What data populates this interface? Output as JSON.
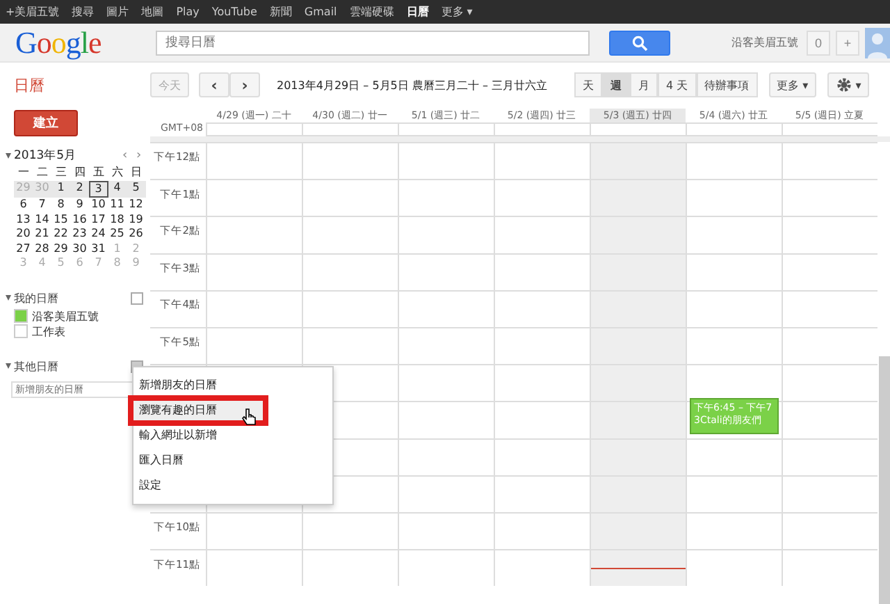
{
  "topbar": {
    "items": [
      {
        "label": "+美眉五號",
        "selected": false
      },
      {
        "label": "搜尋",
        "selected": false
      },
      {
        "label": "圖片",
        "selected": false
      },
      {
        "label": "地圖",
        "selected": false
      },
      {
        "label": "Play",
        "selected": false
      },
      {
        "label": "YouTube",
        "selected": false
      },
      {
        "label": "新聞",
        "selected": false
      },
      {
        "label": "Gmail",
        "selected": false
      },
      {
        "label": "雲端硬碟",
        "selected": false
      },
      {
        "label": "日曆",
        "selected": true
      },
      {
        "label": "更多 ▾",
        "selected": false
      }
    ]
  },
  "header": {
    "logo": "Google",
    "search": {
      "placeholder": "搜尋日曆"
    },
    "user": "沿客美眉五號",
    "notifications": "0",
    "share": "+"
  },
  "toolbar": {
    "app_title": "日曆",
    "today": "今天",
    "prev": "‹",
    "next": "›",
    "date_range": "2013年4月29日 – 5月5日 農曆三月二十 – 三月廿六立",
    "views": [
      {
        "label": "天",
        "selected": false
      },
      {
        "label": "週",
        "selected": true
      },
      {
        "label": "月",
        "selected": false
      },
      {
        "label": "4 天",
        "selected": false
      },
      {
        "label": "待辦事項",
        "selected": false
      }
    ],
    "more": "更多 ▾",
    "settings_caret": "▾"
  },
  "sidebar": {
    "create": "建立",
    "mini_calendar": {
      "title": "2013年5月",
      "prev": "‹",
      "next": "›",
      "weekdays": [
        "一",
        "二",
        "三",
        "四",
        "五",
        "六",
        "日"
      ],
      "weeks": [
        {
          "current": true,
          "days": [
            {
              "d": "29",
              "other": true,
              "today": false
            },
            {
              "d": "30",
              "other": true,
              "today": false
            },
            {
              "d": "1",
              "other": false,
              "today": false
            },
            {
              "d": "2",
              "other": false,
              "today": false
            },
            {
              "d": "3",
              "other": false,
              "today": true
            },
            {
              "d": "4",
              "other": false,
              "today": false
            },
            {
              "d": "5",
              "other": false,
              "today": false
            }
          ]
        },
        {
          "current": false,
          "days": [
            {
              "d": "6",
              "other": false,
              "today": false
            },
            {
              "d": "7",
              "other": false,
              "today": false
            },
            {
              "d": "8",
              "other": false,
              "today": false
            },
            {
              "d": "9",
              "other": false,
              "today": false
            },
            {
              "d": "10",
              "other": false,
              "today": false
            },
            {
              "d": "11",
              "other": false,
              "today": false
            },
            {
              "d": "12",
              "other": false,
              "today": false
            }
          ]
        },
        {
          "current": false,
          "days": [
            {
              "d": "13",
              "other": false,
              "today": false
            },
            {
              "d": "14",
              "other": false,
              "today": false
            },
            {
              "d": "15",
              "other": false,
              "today": false
            },
            {
              "d": "16",
              "other": false,
              "today": false
            },
            {
              "d": "17",
              "other": false,
              "today": false
            },
            {
              "d": "18",
              "other": false,
              "today": false
            },
            {
              "d": "19",
              "other": false,
              "today": false
            }
          ]
        },
        {
          "current": false,
          "days": [
            {
              "d": "20",
              "other": false,
              "today": false
            },
            {
              "d": "21",
              "other": false,
              "today": false
            },
            {
              "d": "22",
              "other": false,
              "today": false
            },
            {
              "d": "23",
              "other": false,
              "today": false
            },
            {
              "d": "24",
              "other": false,
              "today": false
            },
            {
              "d": "25",
              "other": false,
              "today": false
            },
            {
              "d": "26",
              "other": false,
              "today": false
            }
          ]
        },
        {
          "current": false,
          "days": [
            {
              "d": "27",
              "other": false,
              "today": false
            },
            {
              "d": "28",
              "other": false,
              "today": false
            },
            {
              "d": "29",
              "other": false,
              "today": false
            },
            {
              "d": "30",
              "other": false,
              "today": false
            },
            {
              "d": "31",
              "other": false,
              "today": false
            },
            {
              "d": "1",
              "other": true,
              "today": false
            },
            {
              "d": "2",
              "other": true,
              "today": false
            }
          ]
        },
        {
          "current": false,
          "days": [
            {
              "d": "3",
              "other": true,
              "today": false
            },
            {
              "d": "4",
              "other": true,
              "today": false
            },
            {
              "d": "5",
              "other": true,
              "today": false
            },
            {
              "d": "6",
              "other": true,
              "today": false
            },
            {
              "d": "7",
              "other": true,
              "today": false
            },
            {
              "d": "8",
              "other": true,
              "today": false
            },
            {
              "d": "9",
              "other": true,
              "today": false
            }
          ]
        }
      ]
    },
    "my_calendars": {
      "title": "我的日曆",
      "items": [
        {
          "name": "沿客美眉五號",
          "checked": true,
          "color": "#7bd148"
        },
        {
          "name": "工作表",
          "checked": false
        }
      ]
    },
    "other_calendars": {
      "title": "其他日曆",
      "placeholder": "新增朋友的日曆"
    }
  },
  "grid": {
    "timezone": "GMT+08",
    "days": [
      {
        "label": "4/29 (週一) 二十",
        "today": false
      },
      {
        "label": "4/30 (週二) 廿一",
        "today": false
      },
      {
        "label": "5/1 (週三) 廿二",
        "today": false
      },
      {
        "label": "5/2 (週四) 廿三",
        "today": false
      },
      {
        "label": "5/3 (週五) 廿四",
        "today": true
      },
      {
        "label": "5/4 (週六) 廿五",
        "today": false,
        "events": [
          {
            "time": "下午6:45 – 下午7",
            "title": "3Ctali的朋友們"
          }
        ]
      },
      {
        "label": "5/5 (週日) 立夏",
        "today": false
      }
    ],
    "hours_top": [
      "下午12點",
      "下午1點",
      "下午2點",
      "下午3點",
      "下午4點",
      "下午5點"
    ],
    "hours_bottom": [
      "下午10點",
      "下午11點"
    ]
  },
  "menu": {
    "items": [
      {
        "label": "新增朋友的日曆",
        "selected": false
      },
      {
        "label": "瀏覽有趣的日曆",
        "selected": true
      },
      {
        "label": "輸入網址以新增",
        "selected": false
      },
      {
        "label": "匯入日曆",
        "selected": false
      },
      {
        "label": "設定",
        "selected": false
      }
    ]
  }
}
